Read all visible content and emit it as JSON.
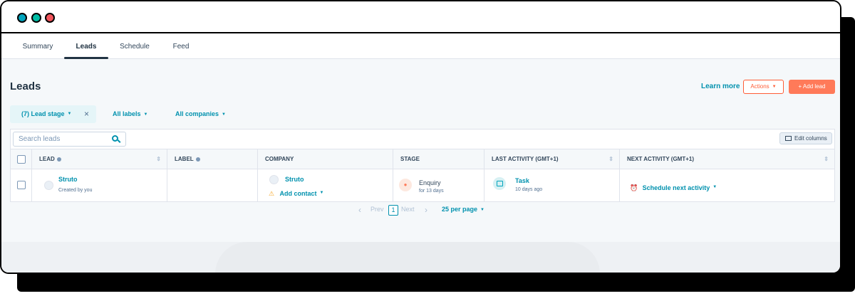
{
  "tabs": [
    {
      "label": "Summary"
    },
    {
      "label": "Leads"
    },
    {
      "label": "Schedule"
    },
    {
      "label": "Feed"
    }
  ],
  "header": {
    "title": "Leads",
    "learn_more": "Learn more",
    "actions_label": "Actions",
    "add_label": "+ Add lead"
  },
  "filters": {
    "lead_stage": "(7) Lead stage",
    "labels": "All labels",
    "companies": "All companies"
  },
  "search": {
    "placeholder": "Search leads"
  },
  "edit_columns": "Edit columns",
  "columns": [
    "LEAD",
    "LABEL",
    "COMPANY",
    "STAGE",
    "LAST ACTIVITY (GMT+1)",
    "NEXT ACTIVITY (GMT+1)"
  ],
  "row": {
    "lead_name": "Struto",
    "lead_sub": "Created by you",
    "label": "",
    "company_name": "Struto",
    "add_contact": "Add contact",
    "stage": "Enquiry",
    "stage_sub": "for 13 days",
    "last_activity": "Task",
    "last_activity_sub": "10 days ago",
    "next_activity": "Schedule next activity"
  },
  "pagination": {
    "prev": "Prev",
    "current": "1",
    "next": "Next",
    "per_page": "25 per page"
  },
  "colors": {
    "accent": "#0091ae",
    "primary_button": "#ff7a59",
    "window_dots": [
      "#00a4bd",
      "#00bda5",
      "#f2545b"
    ]
  }
}
